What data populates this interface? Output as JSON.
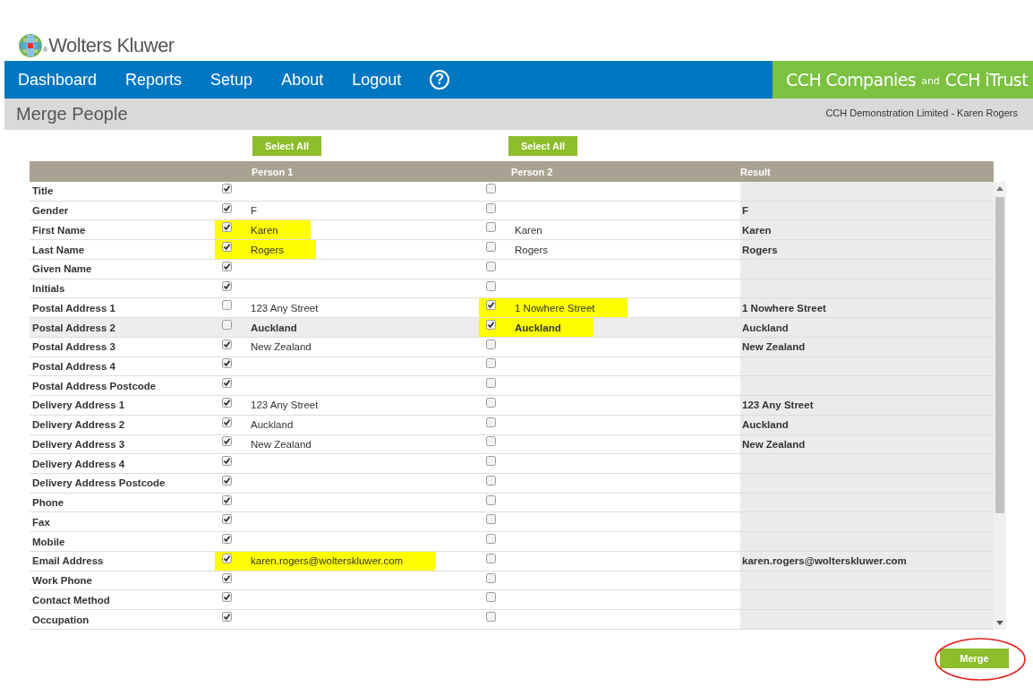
{
  "logo": {
    "name": "Wolters Kluwer",
    "registered": "®"
  },
  "nav": {
    "items": [
      {
        "label": "Dashboard"
      },
      {
        "label": "Reports"
      },
      {
        "label": "Setup"
      },
      {
        "label": "About"
      },
      {
        "label": "Logout"
      }
    ],
    "help": "?"
  },
  "brand": {
    "first": "CCH Companies",
    "joiner": "and",
    "second": "CCH iTrust"
  },
  "page": {
    "title": "Merge People",
    "context": "CCH Demonstration Limited - Karen Rogers"
  },
  "select_all_buttons": [
    "Select All",
    "Select All"
  ],
  "table": {
    "columns": [
      "Person 1",
      "Person 2",
      "Result"
    ],
    "rows": [
      {
        "label": "Title",
        "selected": false,
        "person_1": {
          "checked": true,
          "highlighted": false
        },
        "person_2": {
          "checked": false,
          "highlighted": false
        }
      },
      {
        "label": "Gender",
        "selected": false,
        "person_1": {
          "checked": true,
          "value": "F",
          "highlighted": false
        },
        "person_2": {
          "checked": false,
          "highlighted": false
        },
        "result": "F"
      },
      {
        "label": "First Name",
        "selected": false,
        "person_1": {
          "checked": true,
          "value": "Karen",
          "highlighted": true
        },
        "person_2": {
          "checked": false,
          "value": "Karen",
          "highlighted": false
        },
        "result": "Karen"
      },
      {
        "label": "Last Name",
        "selected": false,
        "person_1": {
          "checked": true,
          "value": "Rogers",
          "highlighted": true
        },
        "person_2": {
          "checked": false,
          "value": "Rogers",
          "highlighted": false
        },
        "result": "Rogers"
      },
      {
        "label": "Given Name",
        "selected": false,
        "person_1": {
          "checked": true,
          "highlighted": false
        },
        "person_2": {
          "checked": false,
          "highlighted": false
        }
      },
      {
        "label": "Initials",
        "selected": false,
        "person_1": {
          "checked": true,
          "highlighted": false
        },
        "person_2": {
          "checked": false,
          "highlighted": false
        }
      },
      {
        "label": "Postal Address 1",
        "selected": false,
        "person_1": {
          "checked": false,
          "value": "123 Any Street",
          "highlighted": false
        },
        "person_2": {
          "checked": true,
          "value": "1 Nowhere Street",
          "highlighted": true
        },
        "result": "1 Nowhere Street"
      },
      {
        "label": "Postal Address 2",
        "selected": true,
        "person_1": {
          "checked": false,
          "value": "Auckland",
          "highlighted": false
        },
        "person_2": {
          "checked": true,
          "value": "Auckland",
          "highlighted": true
        },
        "result": "Auckland"
      },
      {
        "label": "Postal Address 3",
        "selected": false,
        "person_1": {
          "checked": true,
          "value": "New Zealand",
          "highlighted": false
        },
        "person_2": {
          "checked": false,
          "highlighted": false
        },
        "result": "New Zealand"
      },
      {
        "label": "Postal Address 4",
        "selected": false,
        "person_1": {
          "checked": true,
          "highlighted": false
        },
        "person_2": {
          "checked": false,
          "highlighted": false
        }
      },
      {
        "label": "Postal Address Postcode",
        "selected": false,
        "person_1": {
          "checked": true,
          "highlighted": false
        },
        "person_2": {
          "checked": false,
          "highlighted": false
        }
      },
      {
        "label": "Delivery Address 1",
        "selected": false,
        "person_1": {
          "checked": true,
          "value": "123 Any Street",
          "highlighted": false
        },
        "person_2": {
          "checked": false,
          "highlighted": false
        },
        "result": "123 Any Street"
      },
      {
        "label": "Delivery Address 2",
        "selected": false,
        "person_1": {
          "checked": true,
          "value": "Auckland",
          "highlighted": false
        },
        "person_2": {
          "checked": false,
          "highlighted": false
        },
        "result": "Auckland"
      },
      {
        "label": "Delivery Address 3",
        "selected": false,
        "person_1": {
          "checked": true,
          "value": "New Zealand",
          "highlighted": false
        },
        "person_2": {
          "checked": false,
          "highlighted": false
        },
        "result": "New Zealand"
      },
      {
        "label": "Delivery Address 4",
        "selected": false,
        "person_1": {
          "checked": true,
          "highlighted": false
        },
        "person_2": {
          "checked": false,
          "highlighted": false
        }
      },
      {
        "label": "Delivery Address Postcode",
        "selected": false,
        "person_1": {
          "checked": true,
          "highlighted": false
        },
        "person_2": {
          "checked": false,
          "highlighted": false
        }
      },
      {
        "label": "Phone",
        "selected": false,
        "person_1": {
          "checked": true,
          "highlighted": false
        },
        "person_2": {
          "checked": false,
          "highlighted": false
        }
      },
      {
        "label": "Fax",
        "selected": false,
        "person_1": {
          "checked": true,
          "highlighted": false
        },
        "person_2": {
          "checked": false,
          "highlighted": false
        }
      },
      {
        "label": "Mobile",
        "selected": false,
        "person_1": {
          "checked": true,
          "highlighted": false
        },
        "person_2": {
          "checked": false,
          "highlighted": false
        }
      },
      {
        "label": "Email Address",
        "selected": false,
        "person_1": {
          "checked": true,
          "value": "karen.rogers@wolterskluwer.com",
          "highlighted": true
        },
        "person_2": {
          "checked": false,
          "highlighted": false
        },
        "result": "karen.rogers@wolterskluwer.com"
      },
      {
        "label": "Work Phone",
        "selected": false,
        "person_1": {
          "checked": true,
          "highlighted": false
        },
        "person_2": {
          "checked": false,
          "highlighted": false
        }
      },
      {
        "label": "Contact Method",
        "selected": false,
        "person_1": {
          "checked": true,
          "highlighted": false
        },
        "person_2": {
          "checked": false,
          "highlighted": false
        }
      },
      {
        "label": "Occupation",
        "selected": false,
        "person_1": {
          "checked": true,
          "highlighted": false
        },
        "person_2": {
          "checked": false,
          "highlighted": false
        }
      }
    ]
  },
  "merge_button": {
    "label": "Merge",
    "circled": true
  }
}
